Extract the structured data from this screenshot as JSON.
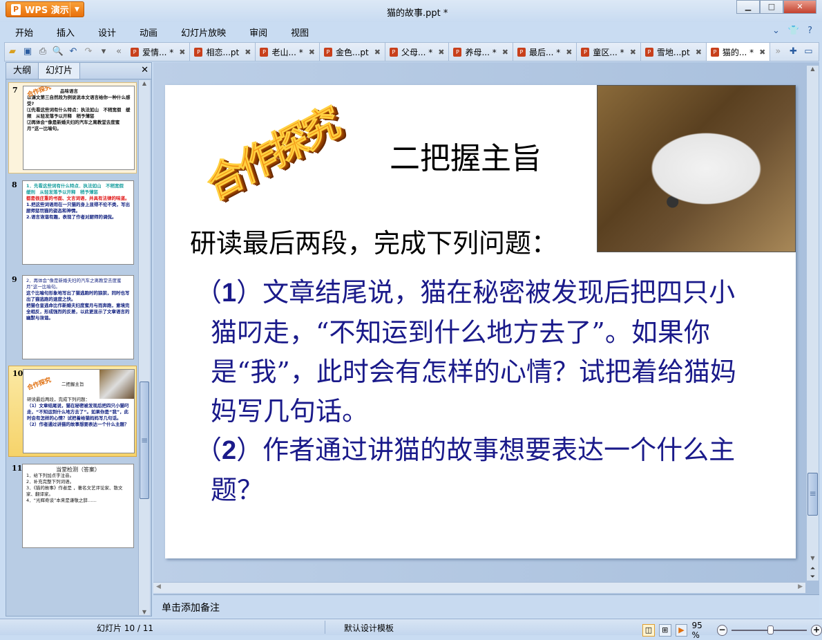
{
  "app": {
    "name": "WPS 演示",
    "document_title": "猫的故事.ppt *"
  },
  "menu": [
    "开始",
    "插入",
    "设计",
    "动画",
    "幻灯片放映",
    "审阅",
    "视图"
  ],
  "doc_tabs": [
    {
      "label": "爱情... *"
    },
    {
      "label": "相恋...pt"
    },
    {
      "label": "老山... *"
    },
    {
      "label": "金色...pt"
    },
    {
      "label": "父母... *"
    },
    {
      "label": "养母... *"
    },
    {
      "label": "最后... *"
    },
    {
      "label": "童区... *"
    },
    {
      "label": "雪地...pt"
    },
    {
      "label": "猫的... *",
      "active": true
    }
  ],
  "left_panel": {
    "tabs": [
      "大纲",
      "幻灯片"
    ],
    "active_tab": "幻灯片"
  },
  "thumbnails": [
    {
      "num": "7",
      "title": "品味语言",
      "wordart": "合作探究",
      "lines": [
        "以课文第三自然段为例说说本文语言给你一种什么感受?",
        "⑴先看这些词有什么特点：执法如山　不稍宽假　缓频　从轻发落予以开释　稍予薄惩",
        "⑵再体会“像是新婚夫妇的汽车之离教堂去度蜜月”这一比喻句。"
      ]
    },
    {
      "num": "8",
      "lines": [
        "1．先看这些词有什么特点．执法如山　不稍宽假　缓刑　从轻发落予以开释　稍予薄惩",
        "都是很庄重的书面、文言词语，并具有法律的味道。",
        "1.把这些词语用在一只猫的身上显得不伦不类，写出厨师惩罚猫的姿态和神情。",
        "2.语言诙谐有趣，表现了作者对厨师的调侃。"
      ]
    },
    {
      "num": "9",
      "lines": [
        "2．再体会“像是新婚夫妇的汽车之离教堂去度蜜月”这一比喻句。",
        "这个比喻句形象地写出了猫逃跑时的狼狈，同时也写出了猫逃跑的速度之快。",
        "把猫仓皇逃命比作新婚夫妇度蜜月与而奔跑，意境完全相反，形成强烈的反差，以此更显示了文章语言的幽默与诙谐。"
      ]
    },
    {
      "num": "10",
      "selected": true,
      "title": "二把握主旨",
      "lines": [
        "研读最后两段，完成下列问题：",
        "（1）文章结尾说，猫在秘密被发现后把四只小猫叼走，“不知运到什么地方去了”。如果你是“我”，此时会有怎样的心情？试把着给猫妈妈写几句话。",
        "（2）作者通过讲猫的故事想要表达一个什么主题？"
      ]
    },
    {
      "num": "11",
      "title": "当堂检测（答案）",
      "lines": [
        "1．给下列加点字注音。",
        "2．补充完整下列词语。",
        "3．《猫的故事》作者是 ，著名文艺评论家、散文家、翻译家。",
        "4．“光辉奇谈”本来是谦敬之辞……"
      ]
    }
  ],
  "slide": {
    "wordart": "合作探究",
    "title": "二把握主旨",
    "subtitle": "研读最后两段，完成下列问题：",
    "q1_num": "1",
    "q1": "文章结尾说，猫在秘密被发现后把四只小猫叼走，“不知运到什么地方去了”。如果你是“我”，此时会有怎样的心情？试把着给猫妈妈写几句话。",
    "q2_num": "2",
    "q2": "作者通过讲猫的故事想要表达一个什么主题？",
    "text_color": "#1a1a8a"
  },
  "notes_placeholder": "单击添加备注",
  "status": {
    "slide_indicator": "幻灯片 10 / 11",
    "template": "默认设计模板",
    "zoom": "95 %",
    "zoom_percent": 95
  },
  "accent_color": "#e8700c"
}
